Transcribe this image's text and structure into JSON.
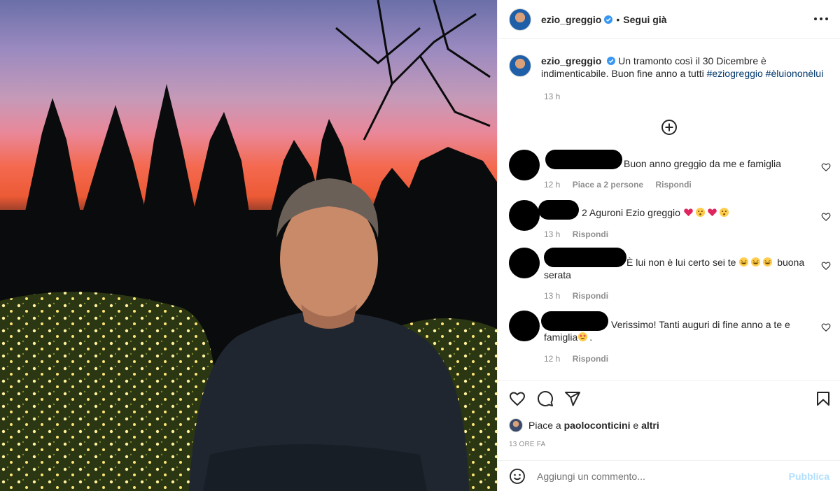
{
  "header": {
    "username": "ezio_greggio",
    "separator": "•",
    "follow_status": "Segui già",
    "more_icon": "more-dots-icon"
  },
  "caption": {
    "username": "ezio_greggio",
    "text": "Un tramonto così il 30 Dicembre è indimenticabile. Buon fine anno a tutti",
    "hashtags": [
      "#eziogreggio",
      "#èluiononèlui"
    ],
    "time": "13 h"
  },
  "load_more_icon": "plus-circle-icon",
  "comments": [
    {
      "text": "Buon anno greggio da me e famiglia",
      "time": "12 h",
      "likes": "Piace a 2 persone",
      "reply": "Rispondi"
    },
    {
      "text": "2 Aguroni Ezio greggio",
      "time": "13 h",
      "likes": "",
      "reply": "Rispondi"
    },
    {
      "text": "È lui non è lui certo sei te",
      "text_end": "buona serata",
      "time": "13 h",
      "likes": "",
      "reply": "Rispondi"
    },
    {
      "text": "Verissimo! Tanti auguri di fine anno a te e famiglia",
      "text_end": ".",
      "time": "12 h",
      "likes": "",
      "reply": "Rispondi"
    }
  ],
  "actions": {
    "like_icon": "heart-icon",
    "comment_icon": "comment-icon",
    "share_icon": "paper-plane-icon",
    "save_icon": "bookmark-icon"
  },
  "likes": {
    "prefix": "Piace a",
    "user": "paoloconticini",
    "conjunction": "e",
    "others": "altri"
  },
  "post_date": "13 ORE FA",
  "add_comment": {
    "placeholder": "Aggiungi un commento...",
    "submit_label": "Pubblica"
  },
  "colors": {
    "verified": "#3897f0",
    "hashtag": "#00376b",
    "muted": "#8e8e8e",
    "publish_disabled": "#b2dffc"
  }
}
